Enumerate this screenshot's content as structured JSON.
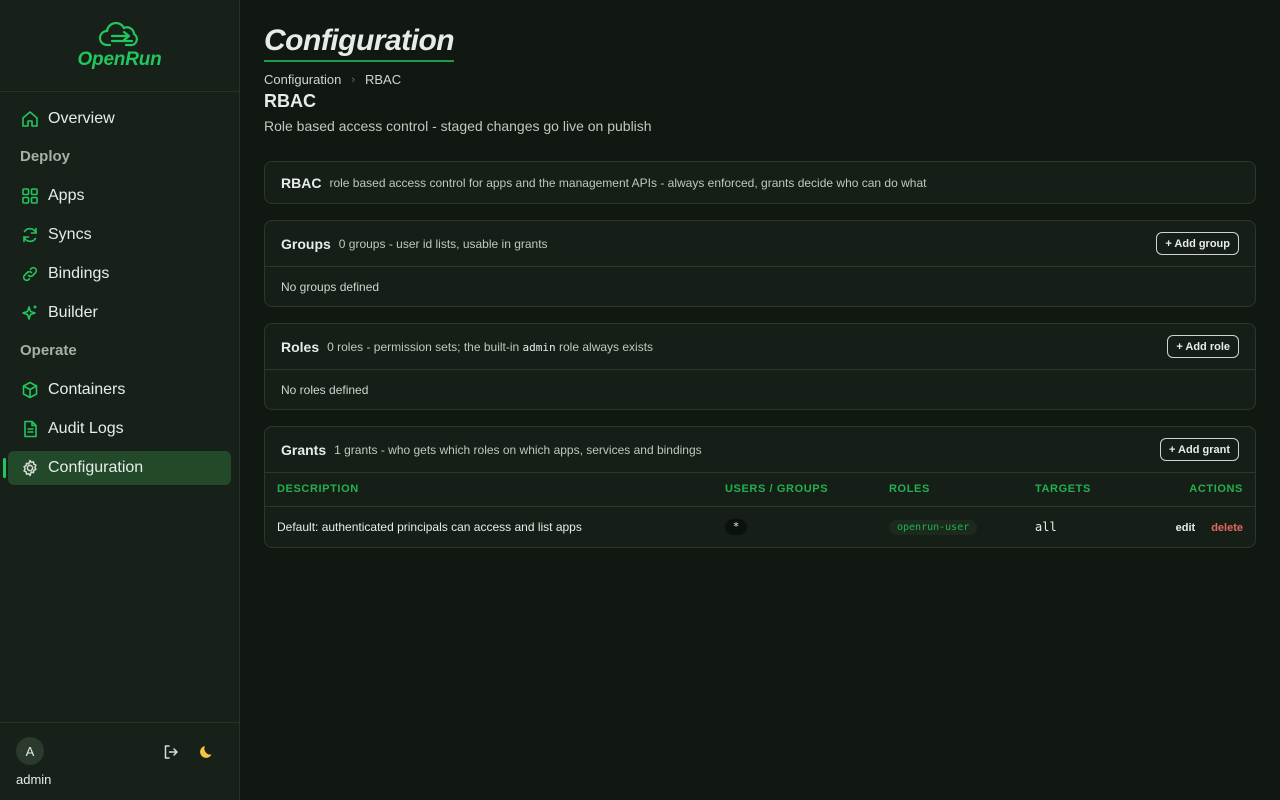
{
  "brand": {
    "name": "OpenRun",
    "accent": "#22c55e"
  },
  "nav": {
    "overview": "Overview",
    "section_deploy": "Deploy",
    "apps": "Apps",
    "syncs": "Syncs",
    "bindings": "Bindings",
    "builder": "Builder",
    "section_operate": "Operate",
    "containers": "Containers",
    "audit_logs": "Audit Logs",
    "configuration": "Configuration",
    "active": "configuration"
  },
  "user": {
    "avatar_letter": "A",
    "name": "admin"
  },
  "page": {
    "title": "Configuration",
    "breadcrumb": [
      "Configuration",
      "RBAC"
    ],
    "section_title": "RBAC",
    "section_subtitle": "Role based access control - staged changes go live on publish"
  },
  "rbac_card": {
    "title": "RBAC",
    "desc": "role based access control for apps and the management APIs - always enforced, grants decide who can do what"
  },
  "groups_card": {
    "title": "Groups",
    "desc": "0 groups - user id lists, usable in grants",
    "button": "+ Add group",
    "empty": "No groups defined"
  },
  "roles_card": {
    "title": "Roles",
    "desc_pre": "0 roles - permission sets; the built-in",
    "desc_code": "admin",
    "desc_post": "role always exists",
    "button": "+ Add role",
    "empty": "No roles defined"
  },
  "grants_card": {
    "title": "Grants",
    "desc": "1 grants - who gets which roles on which apps, services and bindings",
    "button": "+ Add grant",
    "columns": {
      "description": "DESCRIPTION",
      "users": "USERS / GROUPS",
      "roles": "ROLES",
      "targets": "TARGETS",
      "actions": "ACTIONS"
    },
    "rows": [
      {
        "description": "Default: authenticated principals can access and list apps",
        "users": "*",
        "roles": "openrun-user",
        "targets": "all",
        "edit": "edit",
        "delete": "delete"
      }
    ]
  }
}
